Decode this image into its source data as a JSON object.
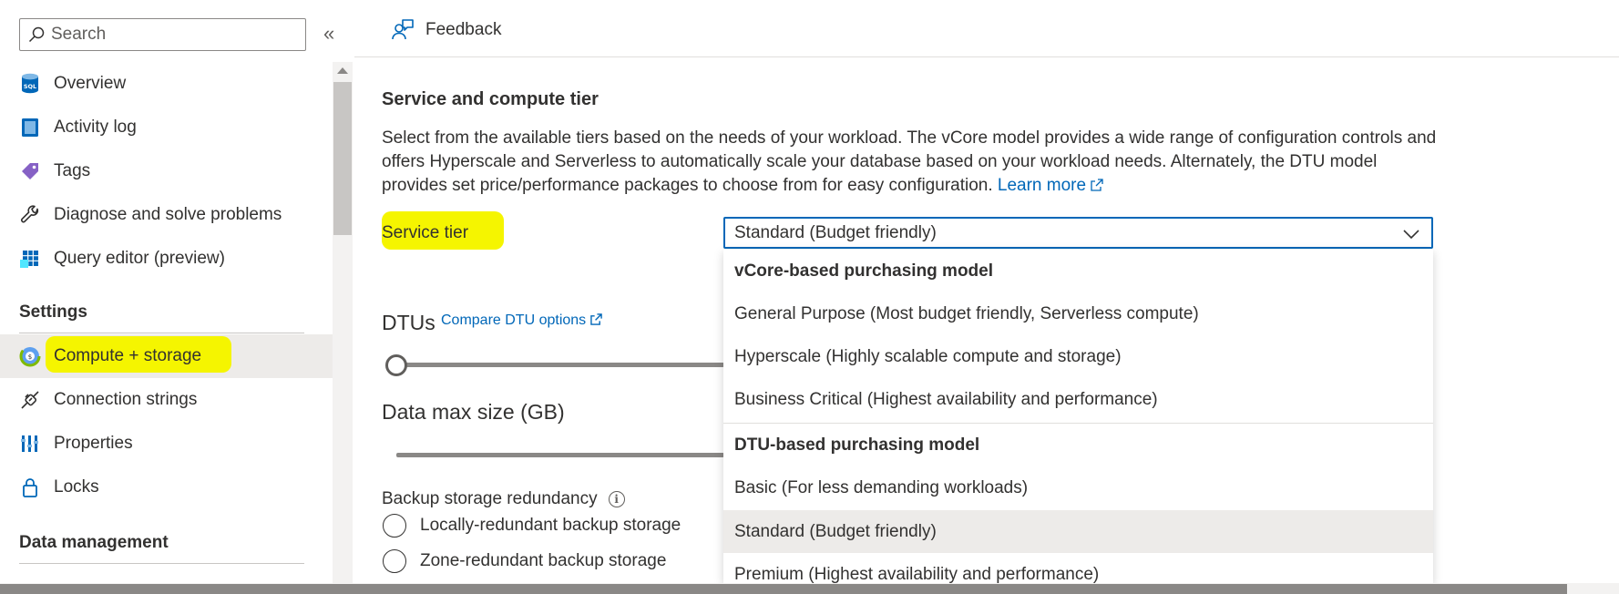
{
  "sidebar": {
    "search_placeholder": "Search",
    "collapse_glyph": "«",
    "items": [
      {
        "label": "Overview",
        "icon": "sql-database-icon"
      },
      {
        "label": "Activity log",
        "icon": "activity-log-icon"
      },
      {
        "label": "Tags",
        "icon": "tag-icon"
      },
      {
        "label": "Diagnose and solve problems",
        "icon": "wrench-icon"
      },
      {
        "label": "Query editor (preview)",
        "icon": "grid-icon"
      }
    ],
    "settings_title": "Settings",
    "settings_items": [
      {
        "label": "Compute + storage",
        "icon": "compute-storage-icon",
        "active": true,
        "highlighted": true
      },
      {
        "label": "Connection strings",
        "icon": "plug-icon"
      },
      {
        "label": "Properties",
        "icon": "properties-icon"
      },
      {
        "label": "Locks",
        "icon": "lock-icon"
      }
    ],
    "data_management_title": "Data management"
  },
  "cmdbar": {
    "feedback_label": "Feedback"
  },
  "main": {
    "heading": "Service and compute tier",
    "description": "Select from the available tiers based on the needs of your workload. The vCore model provides a wide range of configuration controls and offers Hyperscale and Serverless to automatically scale your database based on your workload needs. Alternately, the DTU model provides set price/performance packages to choose from for easy configuration.",
    "learn_more": "Learn more",
    "service_tier_label": "Service tier",
    "service_tier_value": "Standard (Budget friendly)",
    "dtus_label": "DTUs",
    "compare_dtu_link": "Compare DTU options",
    "data_max_size_label": "Data max size (GB)",
    "backup_label": "Backup storage redundancy",
    "backup_options": [
      "Locally-redundant backup storage",
      "Zone-redundant backup storage"
    ]
  },
  "dropdown": {
    "options": [
      {
        "label": "vCore-based purchasing model",
        "type": "header"
      },
      {
        "label": "General Purpose (Most budget friendly, Serverless compute)",
        "type": "option"
      },
      {
        "label": "Hyperscale (Highly scalable compute and storage)",
        "type": "option"
      },
      {
        "label": "Business Critical (Highest availability and performance)",
        "type": "option"
      },
      {
        "label": "DTU-based purchasing model",
        "type": "header"
      },
      {
        "label": "Basic (For less demanding workloads)",
        "type": "option"
      },
      {
        "label": "Standard (Budget friendly)",
        "type": "option",
        "selected": true
      },
      {
        "label": "Premium (Highest availability and performance)",
        "type": "option"
      }
    ]
  },
  "colors": {
    "accent": "#0067b8",
    "highlight": "#f5f500",
    "selected_bg": "#edebe9"
  }
}
